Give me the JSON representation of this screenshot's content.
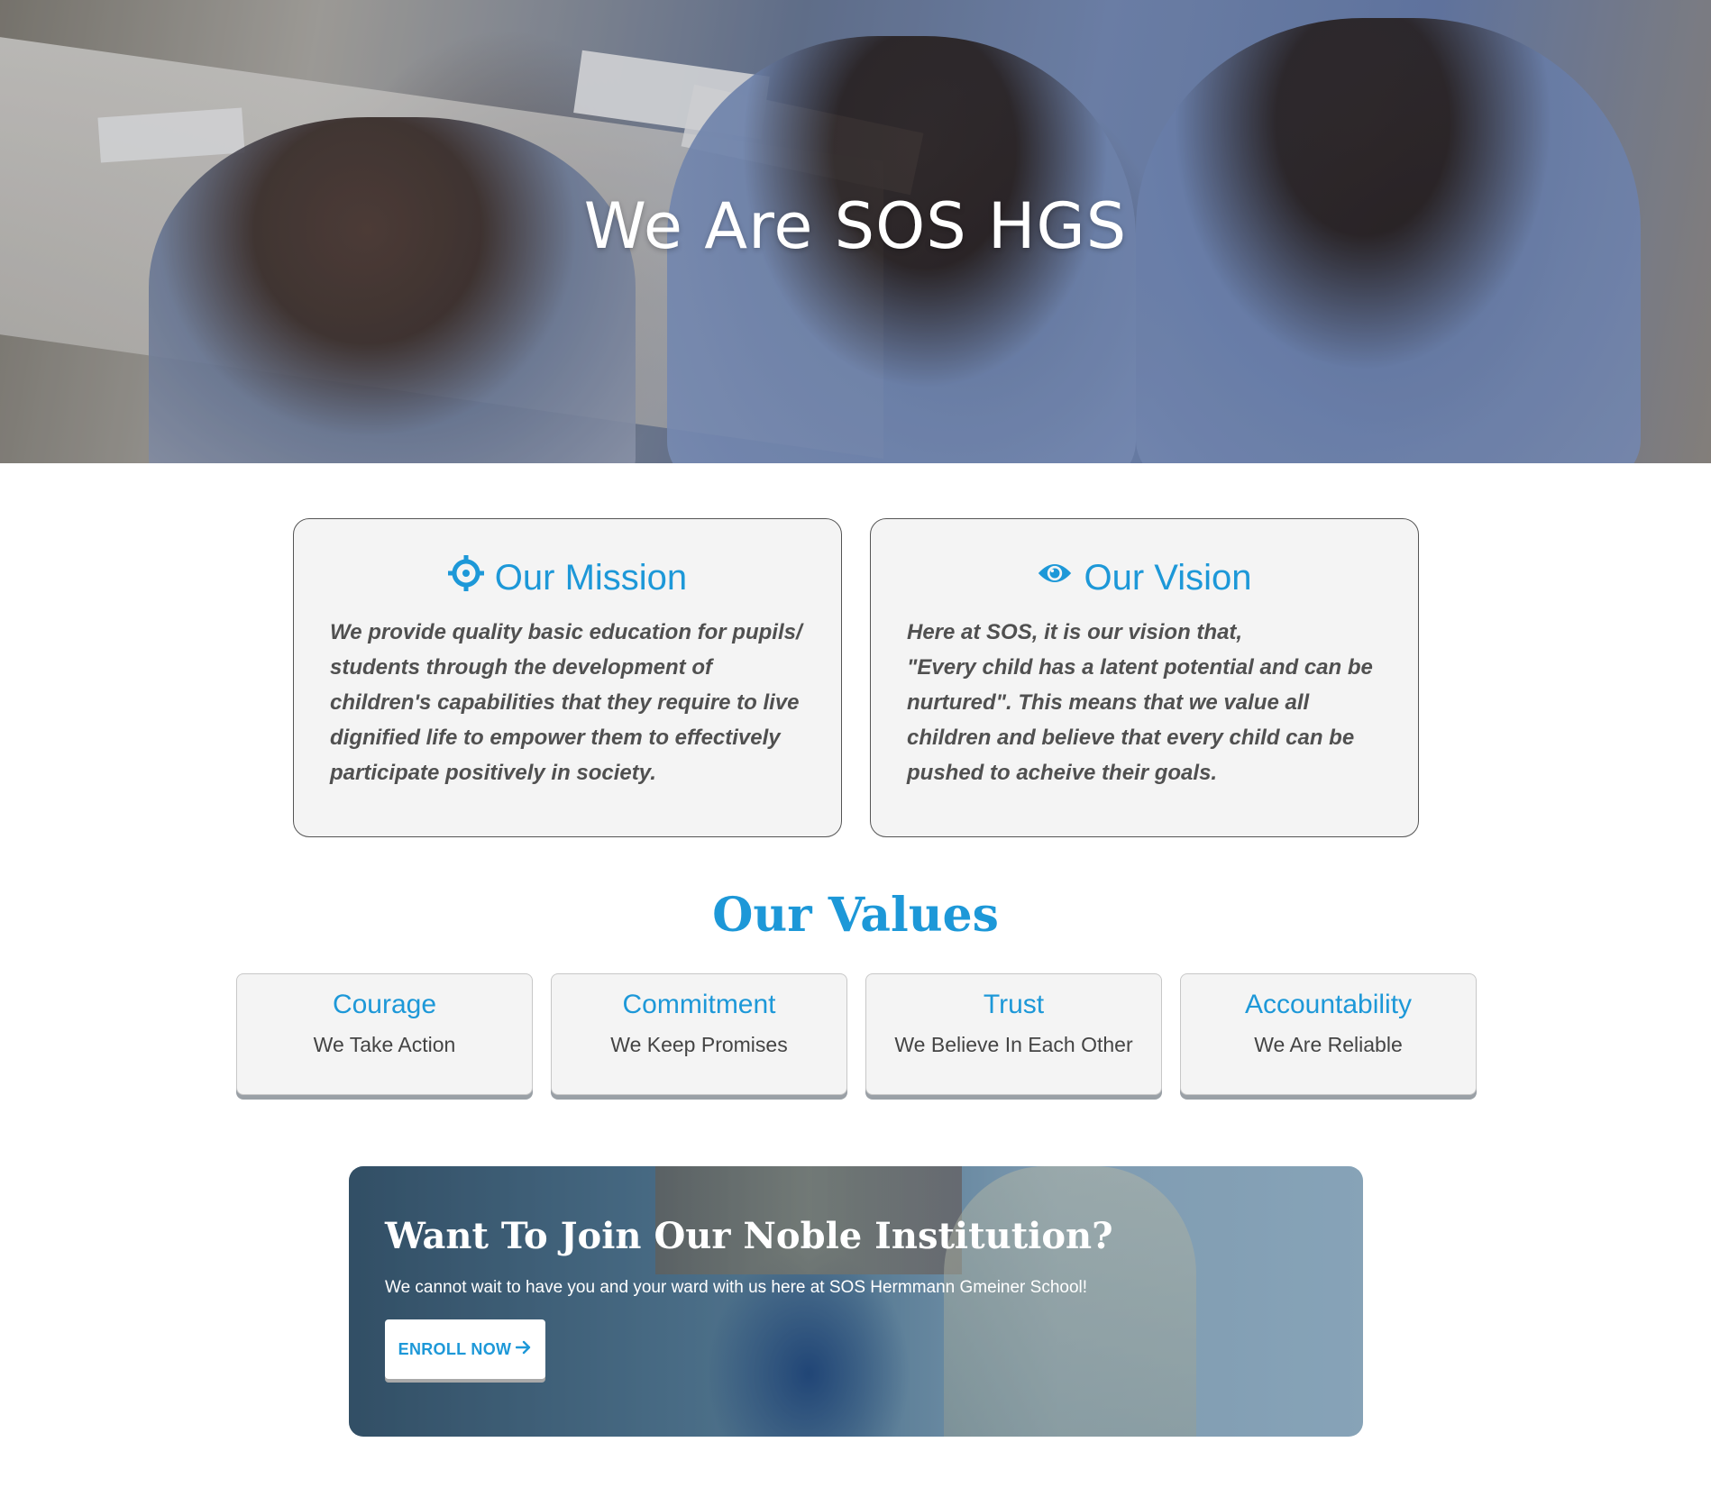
{
  "hero": {
    "title": "We Are SOS HGS"
  },
  "mission": {
    "title": "Our Mission",
    "icon": "crosshair-icon",
    "text": "We provide quality basic education for pupils/ students through the development of children's capabilities that they require to live dignified life to empower them to effectively participate positively in society."
  },
  "vision": {
    "title": "Our Vision",
    "icon": "eye-icon",
    "line1": "Here at SOS, it is our vision that,",
    "line2": "\"Every child has a latent potential and can be nurtured\". This means that we value all children and believe that every child can be pushed to acheive their goals."
  },
  "values": {
    "title": "Our Values",
    "items": [
      {
        "name": "Courage",
        "desc": "We Take Action"
      },
      {
        "name": "Commitment",
        "desc": "We Keep Promises"
      },
      {
        "name": "Trust",
        "desc": "We Believe In Each Other"
      },
      {
        "name": "Accountability",
        "desc": "We Are Reliable"
      }
    ]
  },
  "cta": {
    "title": "Want To Join Our Noble Institution?",
    "subtitle": "We cannot wait to have you and your ward with us here at SOS Hermmann Gmeiner School!",
    "button_label": "ENROLL NOW",
    "button_icon": "arrow-right-icon"
  },
  "colors": {
    "accent": "#1d98d8",
    "card_bg": "#f4f4f4",
    "text": "#505050"
  }
}
